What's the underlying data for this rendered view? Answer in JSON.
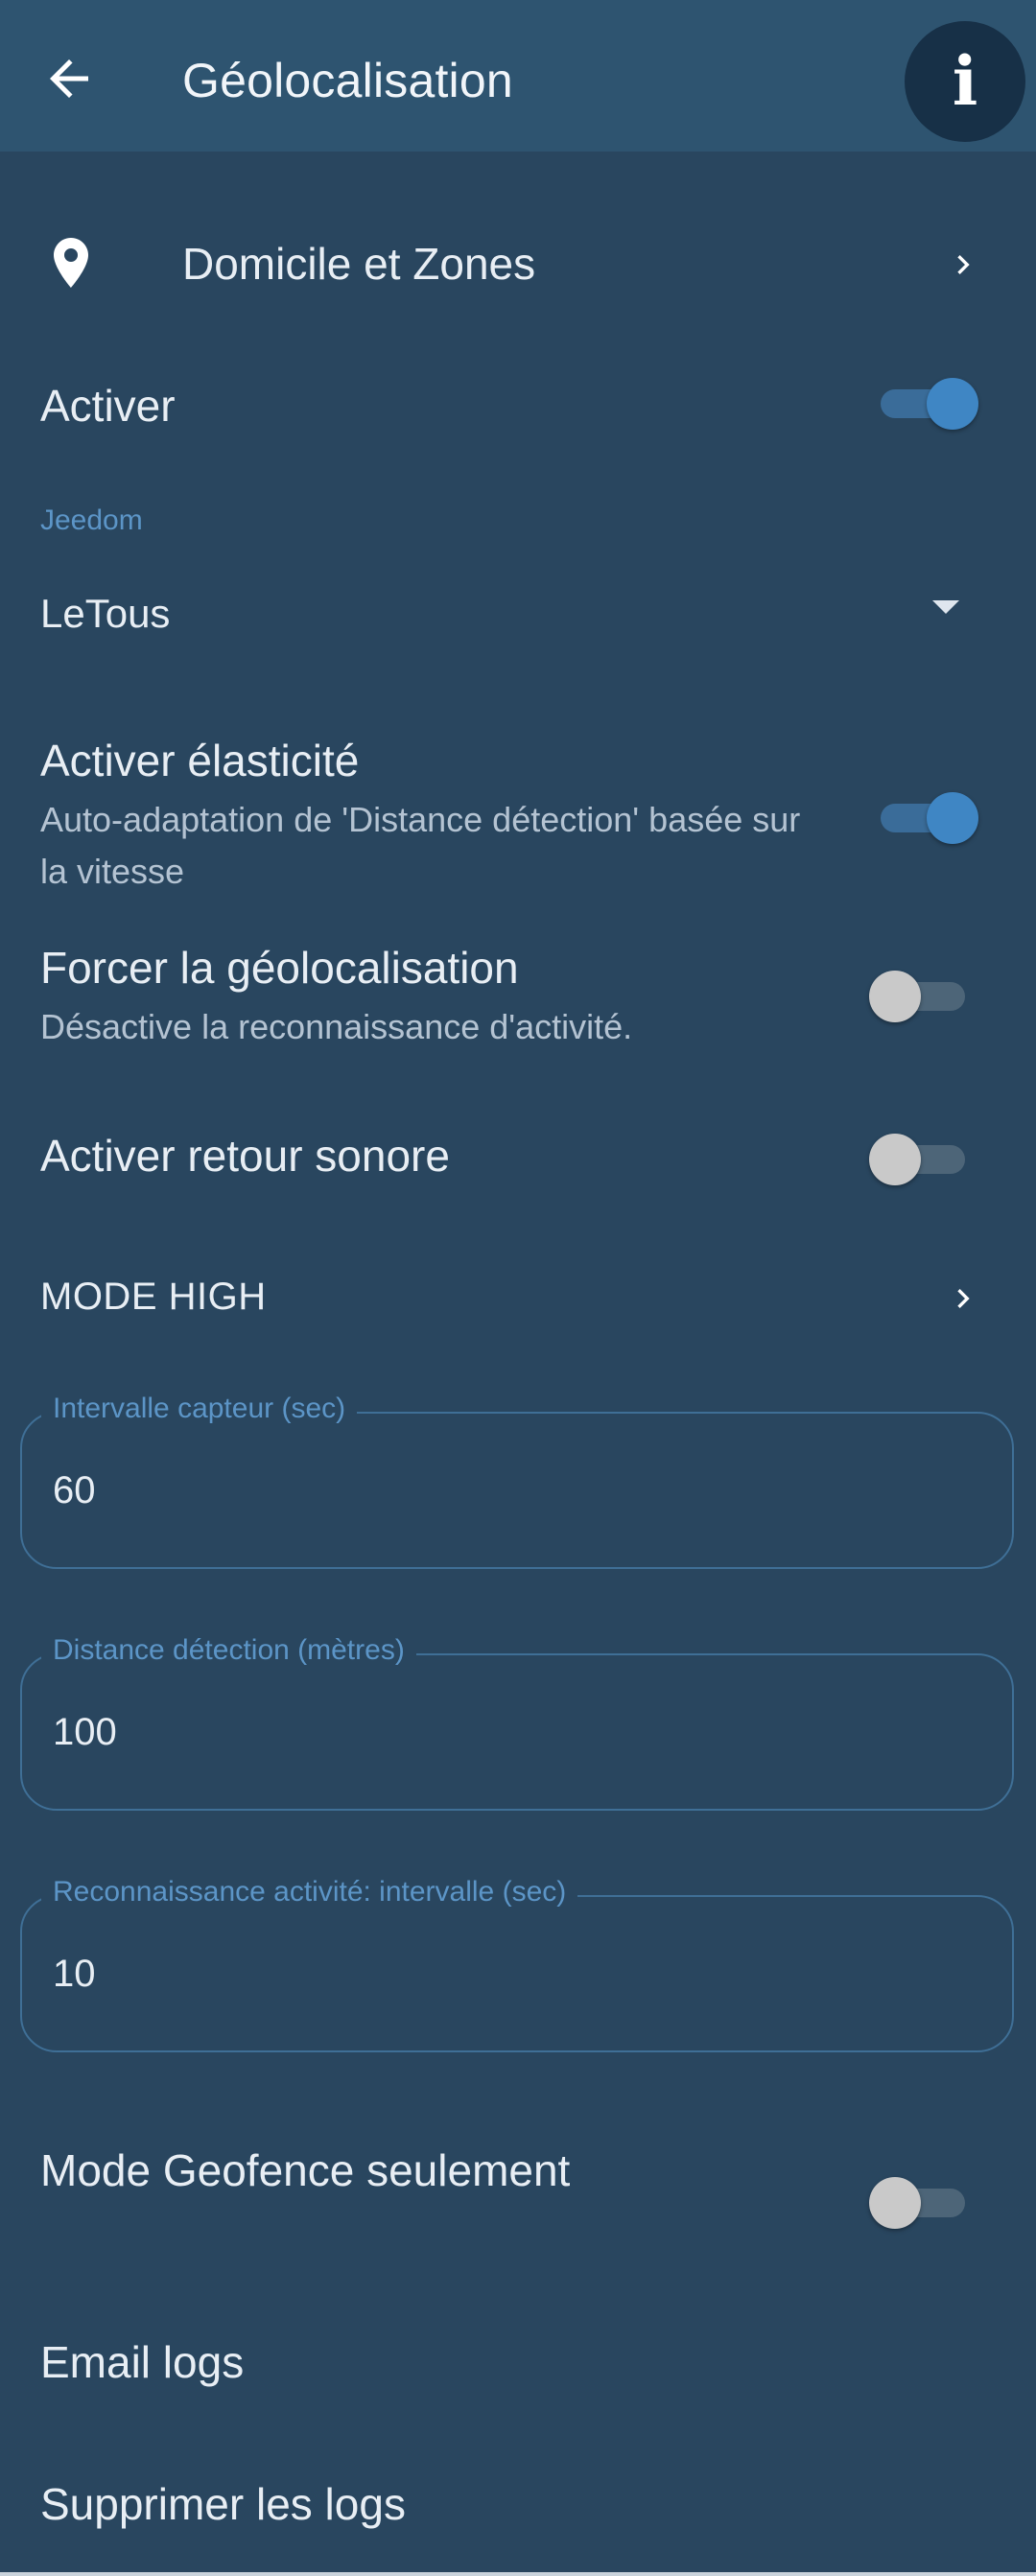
{
  "appbar": {
    "title": "Géolocalisation",
    "back_icon": "arrow-left-icon",
    "info_icon": "info-icon",
    "info_glyph": "i"
  },
  "settings": {
    "home_zones": {
      "label": "Domicile et Zones",
      "icon": "location-pin-icon"
    },
    "enable": {
      "label": "Activer",
      "checked": true
    },
    "jeedom": {
      "label": "Jeedom",
      "value": "LeTous"
    },
    "elasticity": {
      "label": "Activer élasticité",
      "description": "Auto-adaptation de 'Distance détection' basée sur la vitesse",
      "checked": true
    },
    "force_geoloc": {
      "label": "Forcer la géolocalisation",
      "description": "Désactive la reconnaissance d'activité.",
      "checked": false
    },
    "sound_feedback": {
      "label": "Activer retour sonore",
      "checked": false
    },
    "mode_high": {
      "label": "MODE HIGH"
    },
    "sensor_interval": {
      "label": "Intervalle capteur (sec)",
      "value": "60"
    },
    "detection_distance": {
      "label": "Distance détection (mètres)",
      "value": "100"
    },
    "activity_interval": {
      "label": "Reconnaissance activité: intervalle (sec)",
      "value": "10"
    },
    "geofence_only": {
      "label": "Mode Geofence seulement",
      "checked": false
    },
    "email_logs": {
      "label": "Email logs"
    },
    "delete_logs": {
      "label": "Supprimer les logs"
    }
  },
  "colors": {
    "background": "#29465f",
    "appbar": "#2e5470",
    "accent": "#3f86c4",
    "field_label": "#5c95c7"
  }
}
